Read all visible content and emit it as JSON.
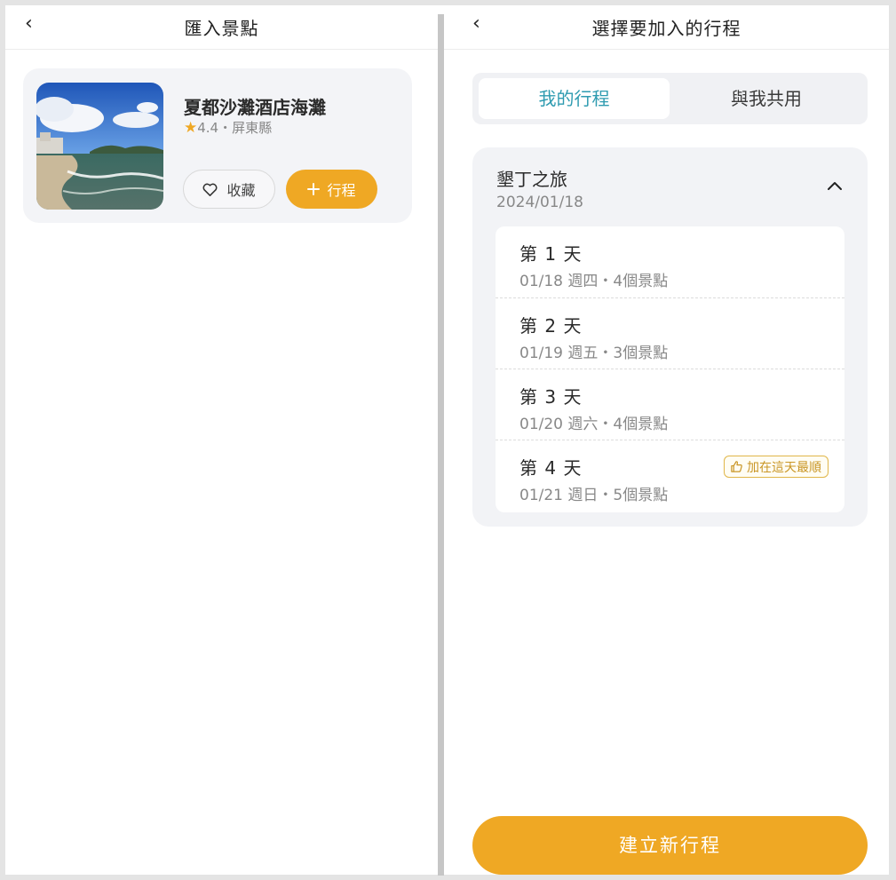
{
  "left": {
    "header": {
      "back": "‹",
      "title": "匯入景點"
    },
    "spot": {
      "name": "夏都沙灘酒店海灘",
      "star": "★",
      "rating": "4.4",
      "sep": "・",
      "location": "屏東縣",
      "fav_label": "收藏",
      "add_label": "行程"
    }
  },
  "right": {
    "header": {
      "back": "‹",
      "title": "選擇要加入的行程"
    },
    "tabs": [
      {
        "label": "我的行程",
        "active": true
      },
      {
        "label": "與我共用",
        "active": false
      }
    ],
    "trip": {
      "name": "墾丁之旅",
      "date": "2024/01/18",
      "days": [
        {
          "title": "第 1 天",
          "sub": "01/18 週四・4個景點"
        },
        {
          "title": "第 2 天",
          "sub": "01/19 週五・3個景點"
        },
        {
          "title": "第 3 天",
          "sub": "01/20 週六・4個景點"
        },
        {
          "title": "第 4 天",
          "sub": "01/21 週日・5個景點",
          "badge": "加在這天最順"
        }
      ]
    },
    "create_label": "建立新行程"
  },
  "colors": {
    "accent": "#efa824",
    "tab_active": "#2e9bb0",
    "badge": "#c99626"
  }
}
